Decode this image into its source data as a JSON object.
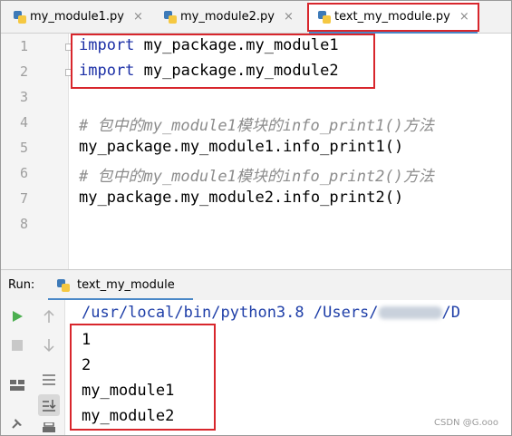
{
  "tabs": [
    {
      "label": "my_module1.py",
      "active": false
    },
    {
      "label": "my_module2.py",
      "active": false
    },
    {
      "label": "text_my_module.py",
      "active": true
    }
  ],
  "tab_close_glyph": "×",
  "editor": {
    "line_numbers": [
      "1",
      "2",
      "3",
      "4",
      "5",
      "6",
      "7",
      "8"
    ],
    "lines": [
      {
        "kw": "import",
        "rest": " my_package.my_module1"
      },
      {
        "kw": "import",
        "rest": " my_package.my_module2"
      },
      {
        "text": ""
      },
      {
        "comment": "# 包中的my_module1模块的info_print1()方法"
      },
      {
        "text": "my_package.my_module1.info_print1()"
      },
      {
        "comment": "# 包中的my_module1模块的info_print2()方法"
      },
      {
        "text": "my_package.my_module2.info_print2()"
      },
      {
        "text": ""
      }
    ]
  },
  "run": {
    "label": "Run:",
    "tab_label": "text_my_module",
    "command_prefix": "/usr/local/bin/python3.8 /Users/",
    "command_suffix": "/D",
    "output": [
      "1",
      "2",
      "my_module1",
      "my_module2"
    ]
  },
  "watermark": "CSDN @G.ooo",
  "colors": {
    "highlight_box": "#d8262c",
    "keyword": "#1b2fa6",
    "comment": "#8c8c8c",
    "path": "#1f3fa8",
    "run_green": "#4caf50",
    "tab_underline": "#4a88c7"
  },
  "icons": [
    "python-file-icon",
    "run-icon",
    "stop-icon",
    "scroll-up-icon",
    "scroll-down-icon",
    "layout-icon",
    "soft-wrap-icon",
    "print-icon",
    "scroll-to-end-icon",
    "pin-icon"
  ]
}
